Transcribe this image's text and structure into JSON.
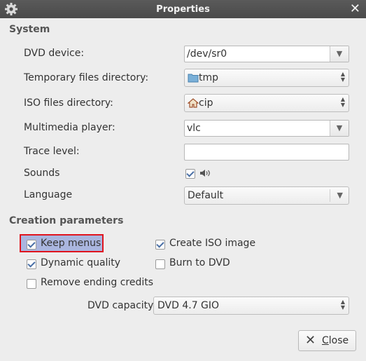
{
  "window": {
    "title": "Properties",
    "close_glyph": "✕"
  },
  "system": {
    "heading": "System",
    "dvd_device": {
      "label": "DVD device:",
      "value": "/dev/sr0"
    },
    "temp_dir": {
      "label": "Temporary files directory:",
      "value": "tmp",
      "icon": "folder-icon"
    },
    "iso_dir": {
      "label": "ISO files directory:",
      "value": "cip",
      "icon": "home-icon"
    },
    "player": {
      "label": "Multimedia player:",
      "value": "vlc"
    },
    "trace": {
      "label": "Trace level:",
      "value": ""
    },
    "sounds": {
      "label": "Sounds",
      "checked": true,
      "icon": "speaker-icon"
    },
    "language": {
      "label": "Language",
      "value": "Default"
    }
  },
  "creation": {
    "heading": "Creation parameters",
    "keep_menus": {
      "label": "Keep menus",
      "checked": true
    },
    "create_iso": {
      "label": "Create ISO image",
      "checked": true
    },
    "dynamic_quality": {
      "label": "Dynamic quality",
      "checked": true
    },
    "burn_dvd": {
      "label": "Burn to DVD",
      "checked": false
    },
    "remove_credits": {
      "label": "Remove ending credits",
      "checked": false
    },
    "capacity": {
      "label": "DVD capacity",
      "value": "DVD 4.7 GIO"
    }
  },
  "buttons": {
    "close_prefix": "",
    "close_mnemonic": "C",
    "close_rest": "lose"
  },
  "colors": {
    "titlebar": "#4f4f4f",
    "highlight_border": "#e0141e",
    "highlight_fill": "#aab6df",
    "check": "#4a6fa5"
  }
}
